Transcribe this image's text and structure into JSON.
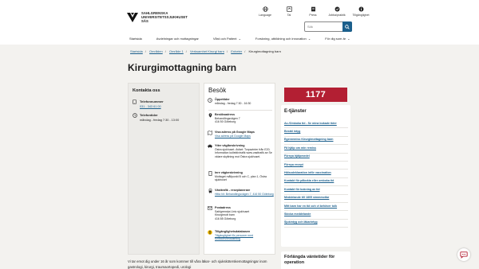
{
  "header": {
    "logo_lines": [
      "SAHLGRENSKA",
      "UNIVERSITETSSJUKHUSET",
      "SÄS"
    ],
    "top_icons": [
      {
        "icon": "globe-icon",
        "label": "Language"
      },
      {
        "icon": "contrast-icon",
        "label": "Tal"
      },
      {
        "icon": "document-icon",
        "label": "Press"
      },
      {
        "icon": "check-icon",
        "label": "Jobba/praktik"
      },
      {
        "icon": "info-icon",
        "label": "Tillgänglighet"
      }
    ],
    "search": {
      "placeholder": "Sök"
    }
  },
  "nav": {
    "items": [
      {
        "label": "Startsida",
        "chevron": false
      },
      {
        "label": "Avdelningar och mottagningar",
        "chevron": false
      },
      {
        "label": "Vård och Patient",
        "chevron": true
      },
      {
        "label": "Forskning, utbildning och innovation",
        "chevron": true
      },
      {
        "label": "För dig som är",
        "chevron": true
      }
    ]
  },
  "breadcrumb": [
    "Startsida",
    "Områden",
    "Område 1",
    "Verksamhet Kirurgi barn",
    "Enheter",
    "Kirurgimottagning barn"
  ],
  "page_title": "Kirurgimottagning barn",
  "contact": {
    "title": "Kontakta oss",
    "phone_label": "Telefonnummer",
    "phone_value": "031 - 343 61 00",
    "hours_label": "Telefontider",
    "hours_value": "måndag - fredag 7:30 - 13:00"
  },
  "visit": {
    "title": "Besök",
    "open_label": "Öppettider",
    "open_value": "måndag - fredag 7:30 - 16:30",
    "addr_label": "Besöksadress",
    "addr_value1": "Behandlingsvägen 7",
    "addr_value2": "416 50 Göteborg",
    "maps_label": "Visa adress på Google Maps",
    "maps_link": "Visa adress på Google Maps",
    "parking_label": "Yttre väglbeskrivning",
    "parking_value": "Östra sjukhuset. Avfart: Torpavinter från E20. Information kollektivtrafik www.vasttrafik.se Se vidare skyltning mot Östra sjukhuset.",
    "inner_label": "Inre vägbeskrivning",
    "inner_value": "Mottaget mållpunkt B och C, plan 1, Östra sjukhuset",
    "transit_label": "Västtrafik - reseplanerare",
    "transit_link": "Hitta hit: Behandlingsvägen 7, 416 50 Göteborg",
    "post_label": "Postadress",
    "post_value1": "Sahlgrenska Univ sjukhuset",
    "post_value2": "Kirurgimott barn",
    "post_value3": "416 85 Göteborg",
    "access_label": "Tillgänglighetsdatabasen",
    "access_link": "Tillgänglighet för personer med funktionsnedsättning"
  },
  "phone_badge": "1177",
  "etjanster": {
    "title": "E-tjänster",
    "items": [
      "Av-/Omboka tid - Se mina bokade tider",
      "Bestäl intyg",
      "Egenremiss Kirurgimottagning barn",
      "Få hjälp om min remiss",
      "Förnya hjälpmedel",
      "Förnya recept",
      "Hälsodeklaration inför vaccination",
      "Kontakt för påbokia eller omboka tid",
      "Kontakt för bokning av tid",
      "Meddelande till 1805 simmmotlar",
      "Mitt barn har en tid och vi behöver tolk",
      "Skicka meddelande",
      "Sjukintyg och läkarintyg"
    ]
  },
  "forl": {
    "title": "Förlängda väntetider för operation"
  },
  "intro_text": "Vi tar emot dig under 16 år som kommer till våra läkar- och sjuksköterskemottagningar inom gastrologi, kirurgi, traumaortopedi, urologi"
}
